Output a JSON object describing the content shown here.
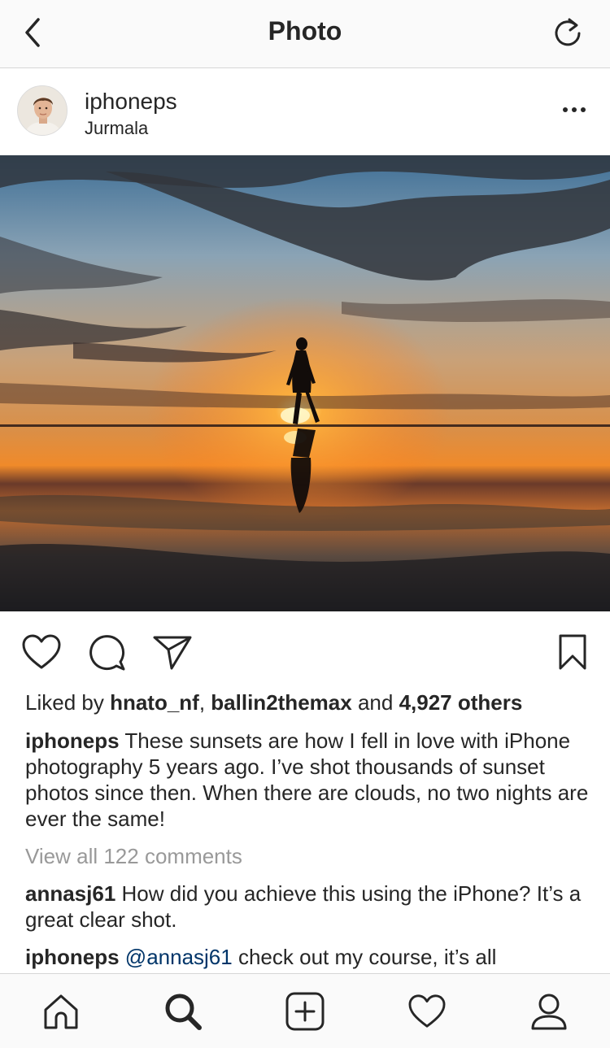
{
  "navbar": {
    "title": "Photo",
    "back_icon": "chevron-left-icon",
    "refresh_icon": "refresh-icon"
  },
  "post": {
    "username": "iphoneps",
    "location": "Jurmala",
    "more_icon": "more-horizontal-icon"
  },
  "actions": {
    "like_icon": "heart-icon",
    "comment_icon": "comment-icon",
    "share_icon": "send-icon",
    "save_icon": "bookmark-icon"
  },
  "likes": {
    "prefix": "Liked by",
    "user1": "hnato_nf",
    "separator": ", ",
    "user2": "ballin2themax",
    "and": "and",
    "others": "4,927 others"
  },
  "caption": {
    "username": "iphoneps",
    "text": "These sunsets are how I fell in love with iPhone photography 5 years ago. I’ve shot thousands of sunset photos since then. When there are clouds, no two nights are ever the same!"
  },
  "comments": {
    "view_all": "View all 122 comments",
    "items": [
      {
        "username": "annasj61",
        "text": "How did you achieve this using the iPhone? It’s a great clear shot."
      },
      {
        "username": "iphoneps",
        "mention": "@annasj61",
        "text": "check out my course, it’s all"
      }
    ]
  },
  "tabbar": {
    "items": [
      "home-icon",
      "search-icon",
      "add-post-icon",
      "activity-heart-icon",
      "profile-icon"
    ],
    "active": "search-icon"
  },
  "colors": {
    "text": "#262626",
    "muted": "#999999",
    "mention": "#003569",
    "bar_background": "#fafafa",
    "divider": "#d6d6d6"
  }
}
